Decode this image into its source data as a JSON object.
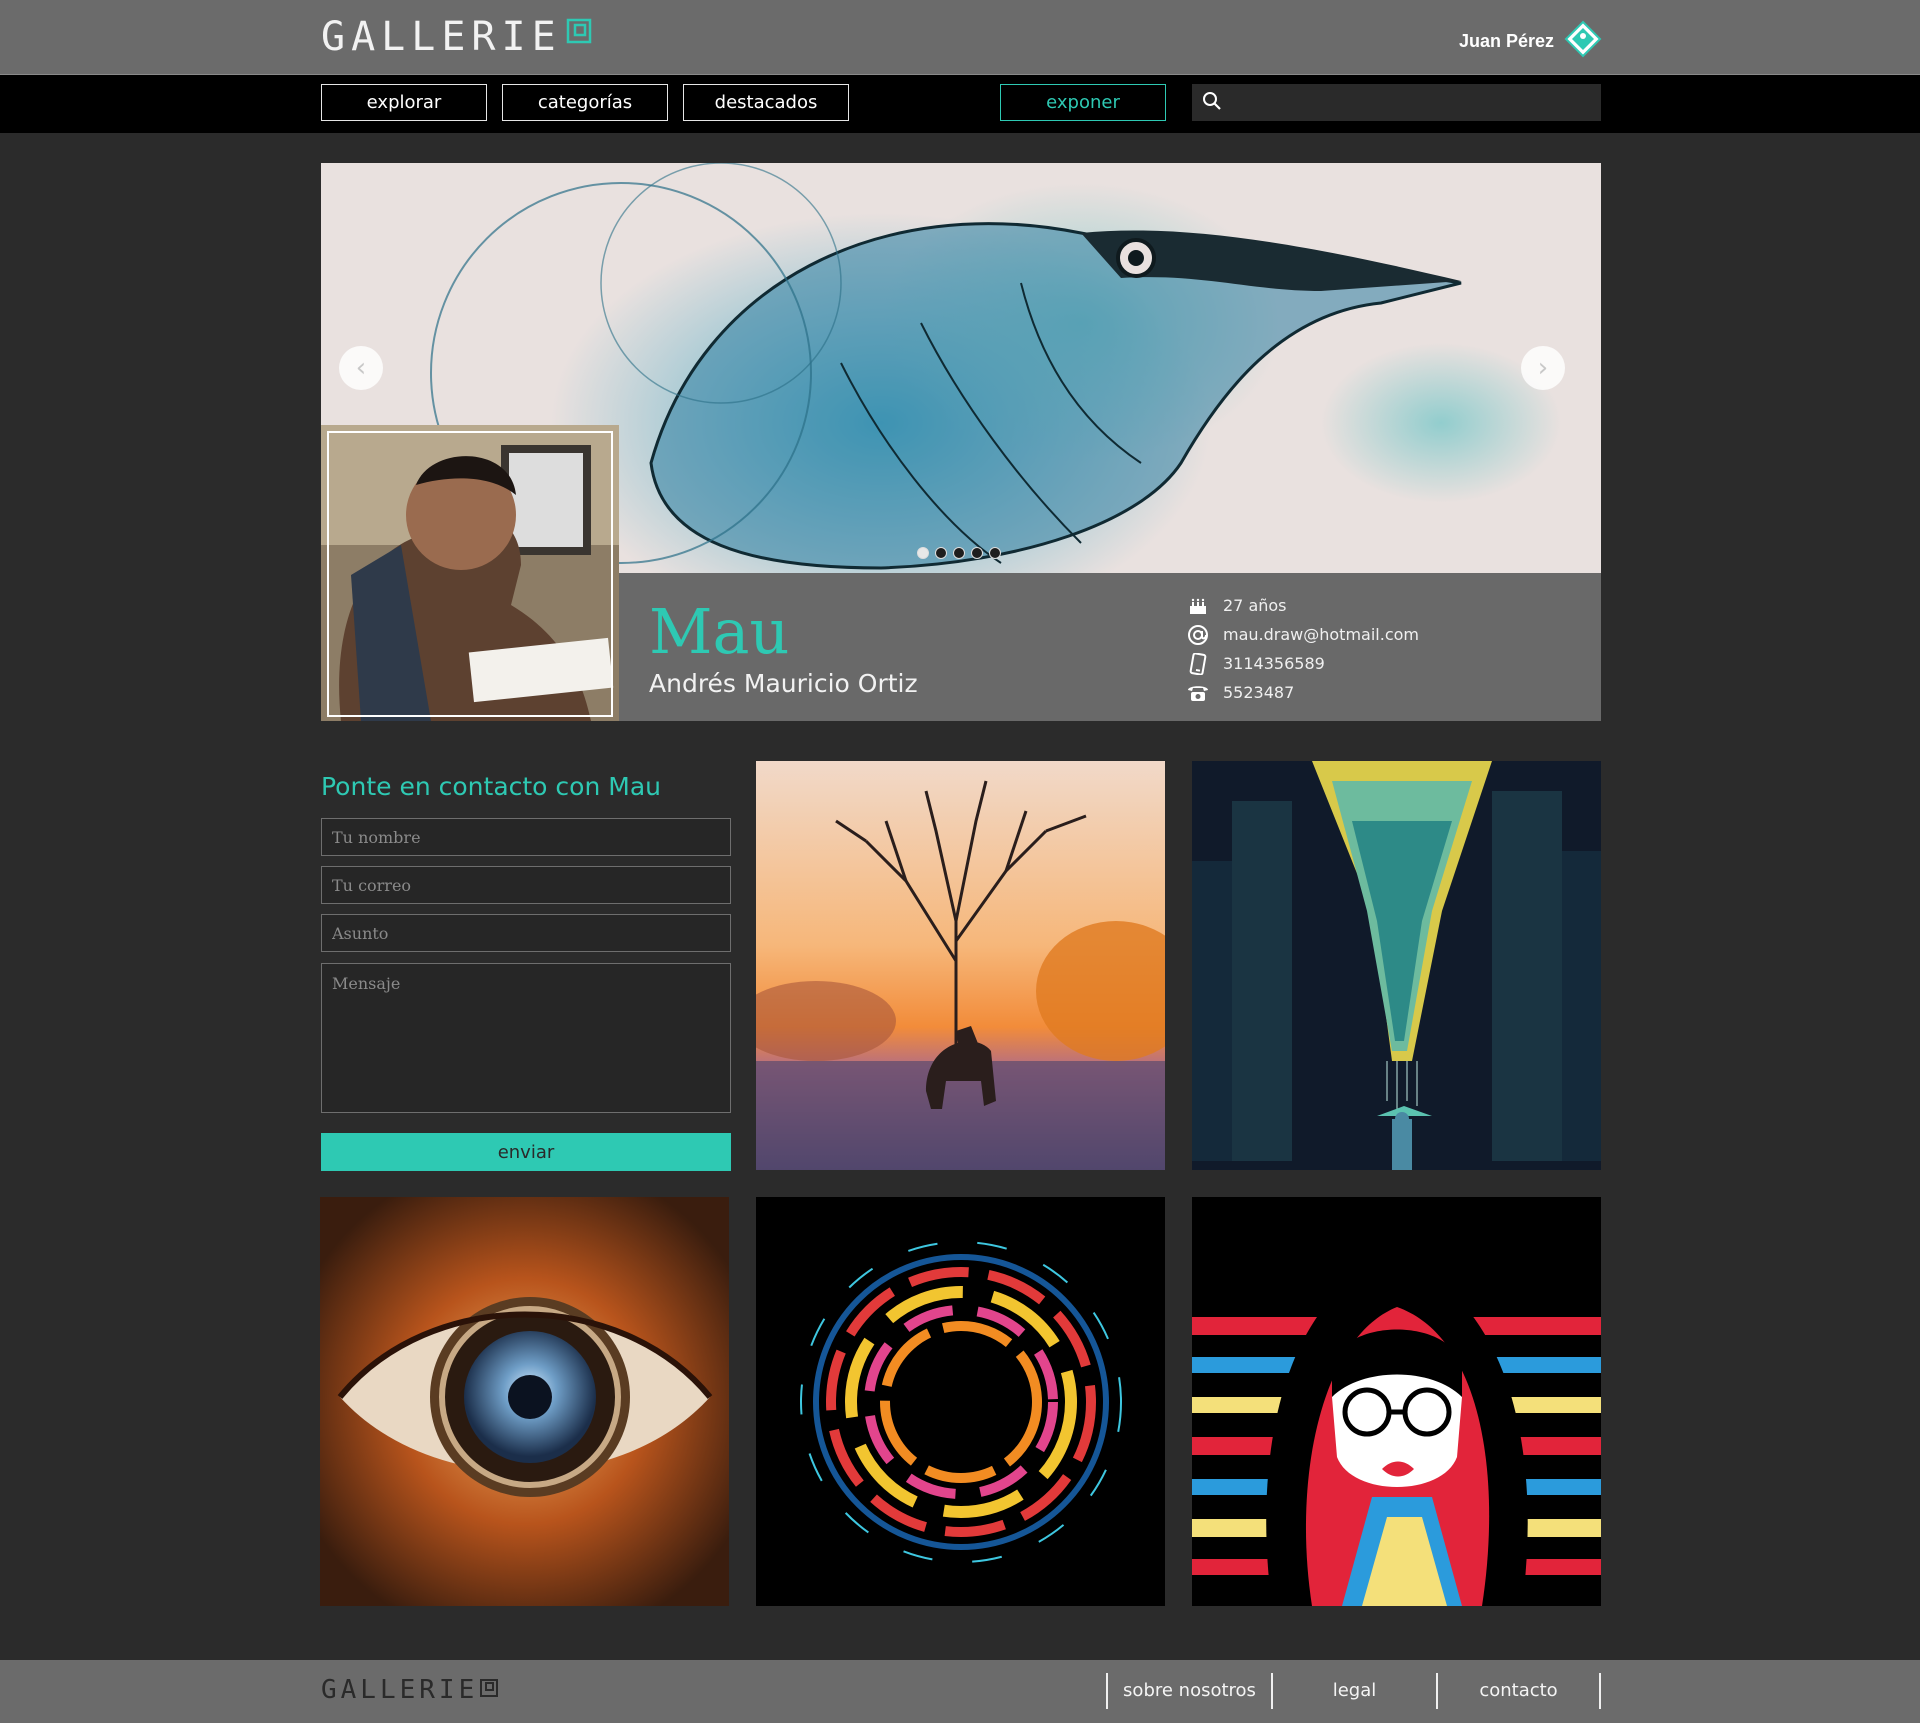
{
  "brand": {
    "name": "GALLERIE",
    "accent": "#2ec9b3"
  },
  "user": {
    "name": "Juan Pérez"
  },
  "nav": {
    "items": [
      {
        "label": "explorar"
      },
      {
        "label": "categorías"
      },
      {
        "label": "destacados"
      }
    ],
    "expose_label": "exponer",
    "search_placeholder": ""
  },
  "hero": {
    "arrow_prev": "‹",
    "arrow_next": "›",
    "slide_count": 5,
    "active_slide": 1
  },
  "artist": {
    "nickname": "Mau",
    "full_name": "Andrés Mauricio Ortiz",
    "age": "27 años",
    "email": "mau.draw@hotmail.com",
    "mobile": "3114356589",
    "phone": "5523487"
  },
  "contact_form": {
    "title": "Ponte en contacto con Mau",
    "name_placeholder": "Tu nombre",
    "email_placeholder": "Tu correo",
    "subject_placeholder": "Asunto",
    "message_placeholder": "Mensaje",
    "submit_label": "enviar"
  },
  "footer": {
    "links": [
      {
        "label": "sobre nosotros"
      },
      {
        "label": "legal"
      },
      {
        "label": "contacto"
      }
    ]
  }
}
